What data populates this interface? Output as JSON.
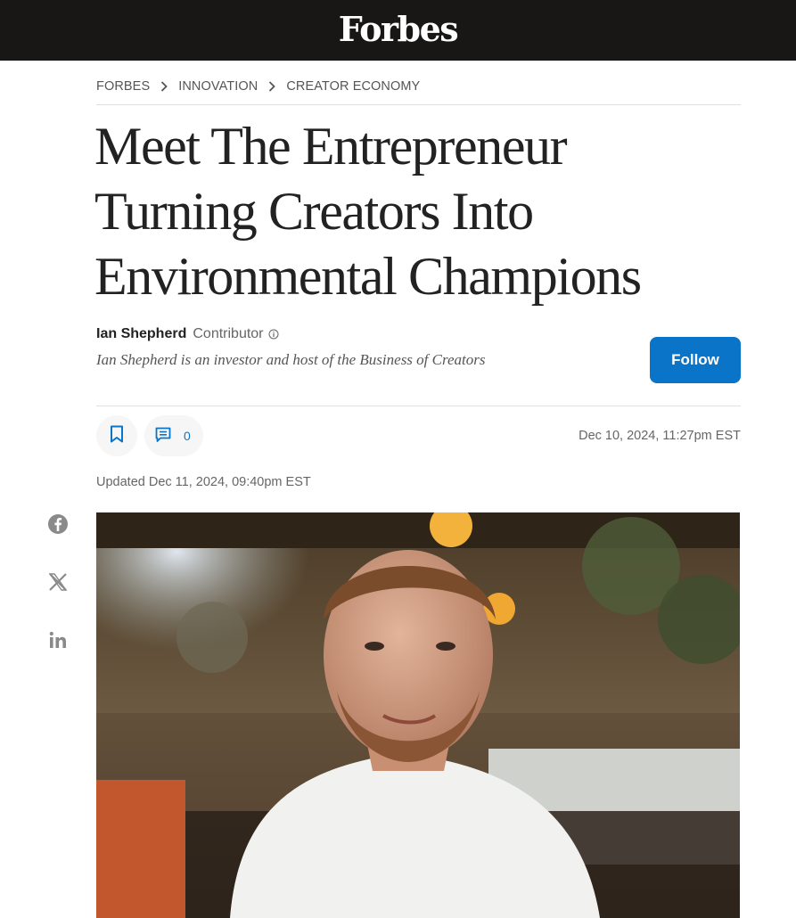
{
  "header": {
    "logo": "Forbes"
  },
  "breadcrumb": {
    "items": [
      "FORBES",
      "INNOVATION",
      "CREATOR ECONOMY"
    ]
  },
  "article": {
    "headline_lines": [
      "Meet The Entrepreneur",
      "Turning Creators Into",
      "Environmental Champions"
    ],
    "author": {
      "name": "Ian Shepherd",
      "role": "Contributor",
      "bio": "Ian Shepherd is an investor and host of the Business of Creators"
    },
    "follow_label": "Follow",
    "comment_count": "0",
    "published": "Dec 10, 2024, 11:27pm EST",
    "updated": "Updated Dec 11, 2024, 09:40pm EST"
  },
  "share": {
    "icons": [
      "facebook-icon",
      "x-icon",
      "linkedin-icon"
    ]
  },
  "colors": {
    "header_bg": "#181716",
    "accent": "#0a74c9",
    "text": "#222222"
  }
}
